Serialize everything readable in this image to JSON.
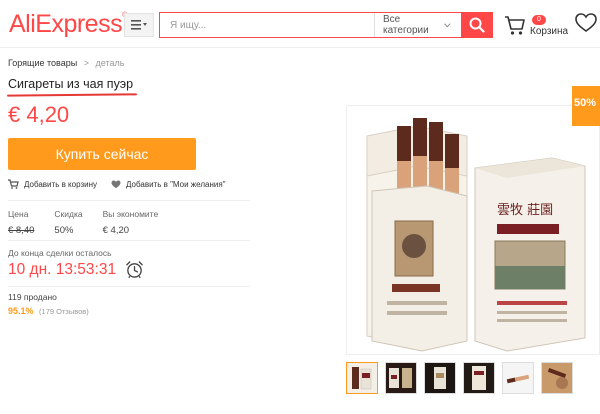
{
  "header": {
    "logo": "AliExpress",
    "logo_mark": "®",
    "search_placeholder": "Я ищу...",
    "category": "Все категории",
    "cart_count": "0",
    "cart_label": "Корзина"
  },
  "breadcrumb": {
    "items": [
      "Горящие товары",
      "деталь"
    ],
    "separator": ">"
  },
  "product": {
    "title": "Сигареты из чая пуэр",
    "price": "€ 4,20",
    "buy_label": "Купить сейчас",
    "add_to_cart": "Добавить в корзину",
    "add_to_wishlist": "Добавить в \"Мои желания\"",
    "stats": {
      "price_label": "Цена",
      "price_old": "€ 8,40",
      "discount_label": "Скидка",
      "discount_val": "50%",
      "save_label": "Вы экономите",
      "save_val": "€ 4,20"
    },
    "deal_label": "До конца сделки осталось",
    "countdown": "10 дн. 13:53:31",
    "sold": "119 продано",
    "rating_pct": "95.1%",
    "rating_count": "(179 Отзывов)",
    "discount_badge": "50%"
  },
  "colors": {
    "brand": "#ff4747",
    "accent": "#ff9a1c"
  },
  "thumbnails_count": 6
}
